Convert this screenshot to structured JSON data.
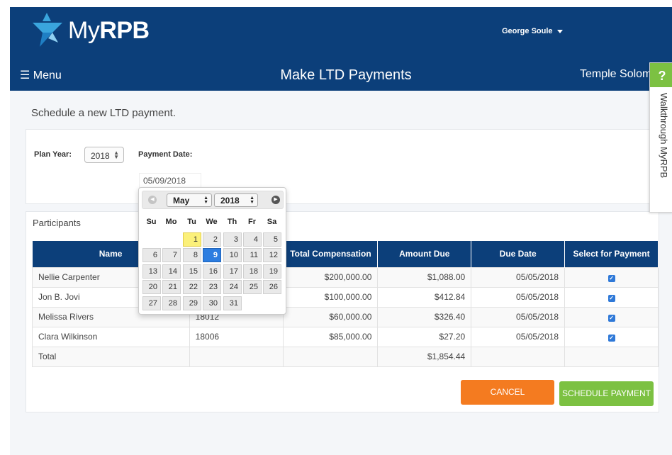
{
  "header": {
    "brand_my": "My",
    "brand_rpb": "RPB",
    "user_name": "George Soule",
    "menu_label": "Menu",
    "page_title": "Make LTD Payments",
    "org_name": "Temple Solom",
    "colors": {
      "header_bg": "#0c3f7a",
      "logo_light": "#3aa5dd",
      "logo_dark": "#1f7fc4"
    }
  },
  "walkthrough": {
    "badge": "?",
    "label": "Walkthrough MyRPB"
  },
  "form": {
    "subtitle": "Schedule a new LTD payment.",
    "plan_year_label": "Plan Year:",
    "plan_year_value": "2018",
    "payment_date_label": "Payment Date:",
    "payment_date_value": "05/09/2018"
  },
  "datepicker": {
    "month": "May",
    "year": "2018",
    "weekdays": [
      "Su",
      "Mo",
      "Tu",
      "We",
      "Th",
      "Fr",
      "Sa"
    ],
    "first_weekday_index": 2,
    "days_in_month": 31,
    "highlighted_day": 1,
    "selected_day": 9
  },
  "participants": {
    "section_label": "Participants",
    "columns": [
      "Name",
      "",
      "Total Compensation",
      "Amount Due",
      "Due Date",
      "Select for Payment"
    ],
    "rows": [
      {
        "name": "Nellie Carpenter",
        "id": "",
        "comp": "$200,000.00",
        "due": "$1,088.00",
        "date": "05/05/2018",
        "selected": true
      },
      {
        "name": "Jon B. Jovi",
        "id": "",
        "comp": "$100,000.00",
        "due": "$412.84",
        "date": "05/05/2018",
        "selected": true
      },
      {
        "name": "Melissa Rivers",
        "id": "18012",
        "comp": "$60,000.00",
        "due": "$326.40",
        "date": "05/05/2018",
        "selected": true
      },
      {
        "name": "Clara Wilkinson",
        "id": "18006",
        "comp": "$85,000.00",
        "due": "$27.20",
        "date": "05/05/2018",
        "selected": true
      }
    ],
    "total_label": "Total",
    "total_amount": "$1,854.44"
  },
  "actions": {
    "cancel_label": "CANCEL",
    "schedule_label": "SCHEDULE PAYMENT",
    "colors": {
      "cancel": "#f47b20",
      "schedule": "#7cc142"
    }
  }
}
